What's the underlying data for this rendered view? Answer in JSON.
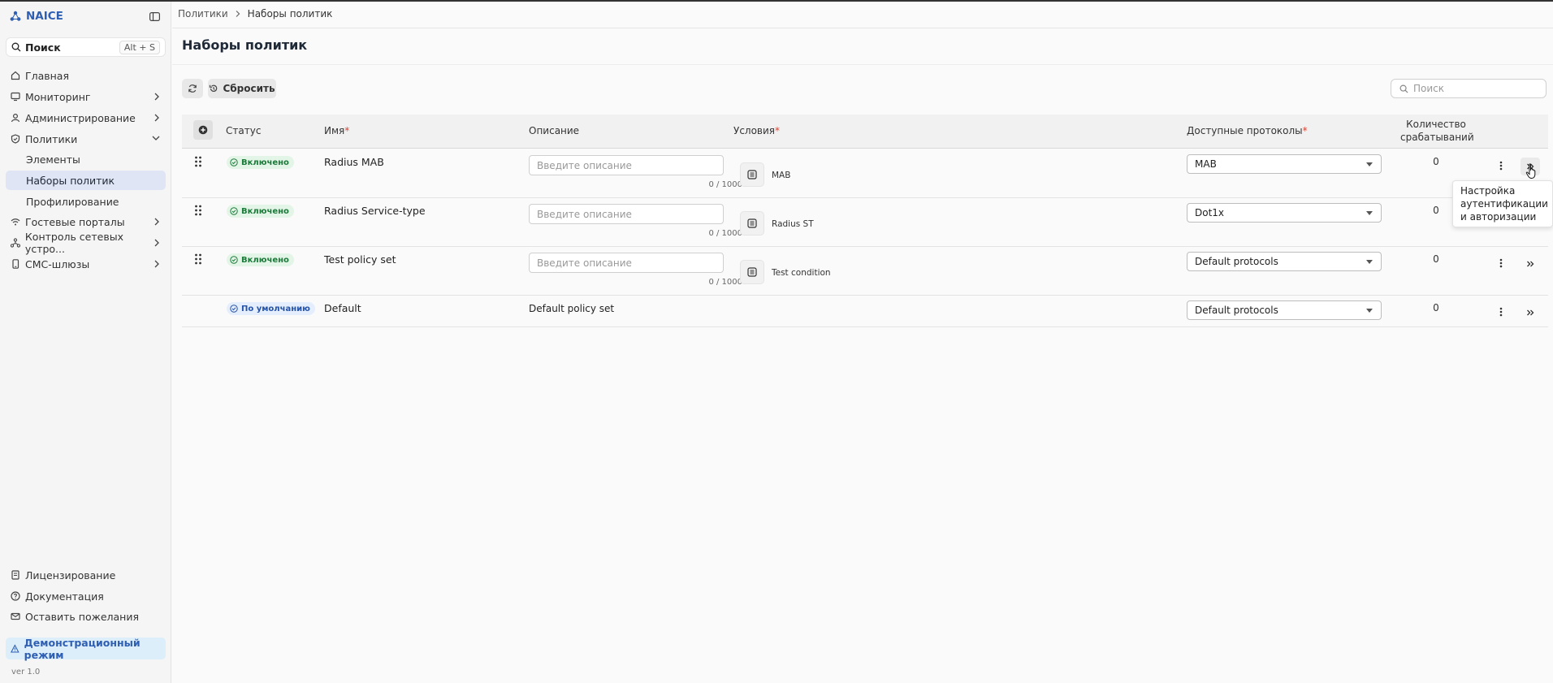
{
  "app": {
    "name": "NAICE",
    "version": "ver 1.0"
  },
  "sidebar": {
    "search_label": "Поиск",
    "search_shortcut": "Alt + S",
    "items": [
      {
        "label": "Главная",
        "icon": "home-icon"
      },
      {
        "label": "Мониторинг",
        "icon": "monitor-icon"
      },
      {
        "label": "Администрирование",
        "icon": "user-icon"
      },
      {
        "label": "Политики",
        "icon": "shield-icon"
      },
      {
        "label": "Элементы"
      },
      {
        "label": "Наборы политик"
      },
      {
        "label": "Профилирование"
      },
      {
        "label": "Гостевые порталы",
        "icon": "wifi-icon"
      },
      {
        "label": "Контроль сетевых устро...",
        "icon": "network-icon"
      },
      {
        "label": "СМС-шлюзы",
        "icon": "phone-icon"
      }
    ],
    "bottom": [
      {
        "label": "Лицензирование",
        "icon": "license-icon"
      },
      {
        "label": "Документация",
        "icon": "help-icon"
      },
      {
        "label": "Оставить пожелания",
        "icon": "mail-icon"
      }
    ],
    "demo_label": "Демонстрационный режим"
  },
  "breadcrumb": {
    "parent": "Политики",
    "current": "Наборы политик"
  },
  "page_title": "Наборы политик",
  "toolbar": {
    "reset_label": "Сбросить",
    "search_placeholder": "Поиск"
  },
  "table": {
    "columns": {
      "status": "Статус",
      "name": "Имя",
      "description": "Описание",
      "conditions": "Условия",
      "protocols": "Доступные протоколы",
      "count_line1": "Количество",
      "count_line2": "срабатываний",
      "required_mark": "*"
    },
    "desc_placeholder": "Введите описание",
    "desc_counter": "0 / 1000",
    "rows": [
      {
        "status": "Включено",
        "name": "Radius MAB",
        "condition": "MAB",
        "protocol": "MAB",
        "count": "0"
      },
      {
        "status": "Включено",
        "name": "Radius Service-type",
        "condition": "Radius ST",
        "protocol": "Dot1x",
        "count": "0"
      },
      {
        "status": "Включено",
        "name": "Test policy set",
        "condition": "Test condition",
        "protocol": "Default protocols",
        "count": "0"
      },
      {
        "status": "По умолчанию",
        "name": "Default",
        "description": "Default policy set",
        "protocol": "Default protocols",
        "count": "0"
      }
    ]
  },
  "tooltip": "Настройка аутентификации и авторизации",
  "colors": {
    "accent": "#2f5fb3",
    "enabled_badge": "#1c7a3a",
    "default_badge": "#2553a8",
    "required": "#dd4433"
  }
}
